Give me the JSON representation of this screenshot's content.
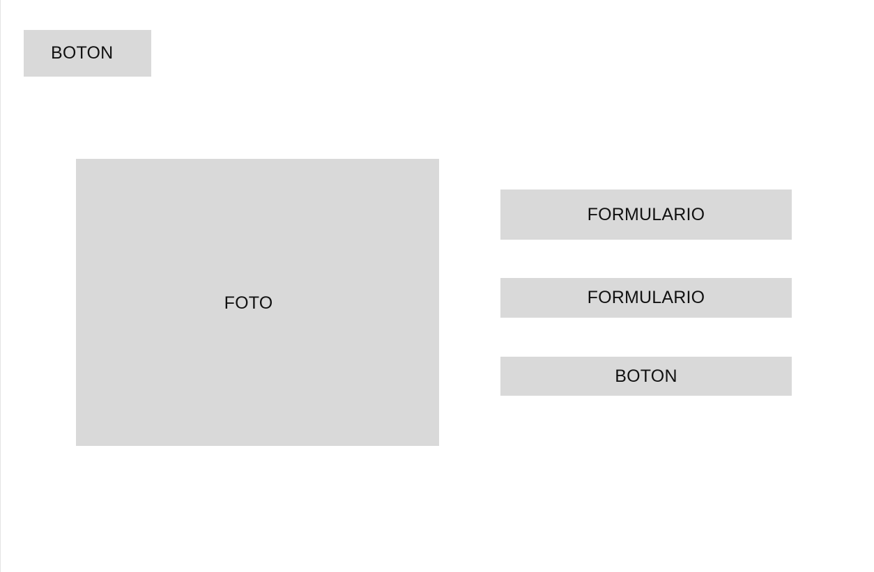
{
  "top_button": {
    "label": "BOTON"
  },
  "photo": {
    "label": "FOTO"
  },
  "form": {
    "fields": [
      {
        "label": "FORMULARIO"
      },
      {
        "label": "FORMULARIO"
      }
    ],
    "button_label": "BOTON"
  },
  "colors": {
    "background": "#ffffff",
    "placeholder_fill": "#d9d9d9",
    "text": "#111111"
  }
}
